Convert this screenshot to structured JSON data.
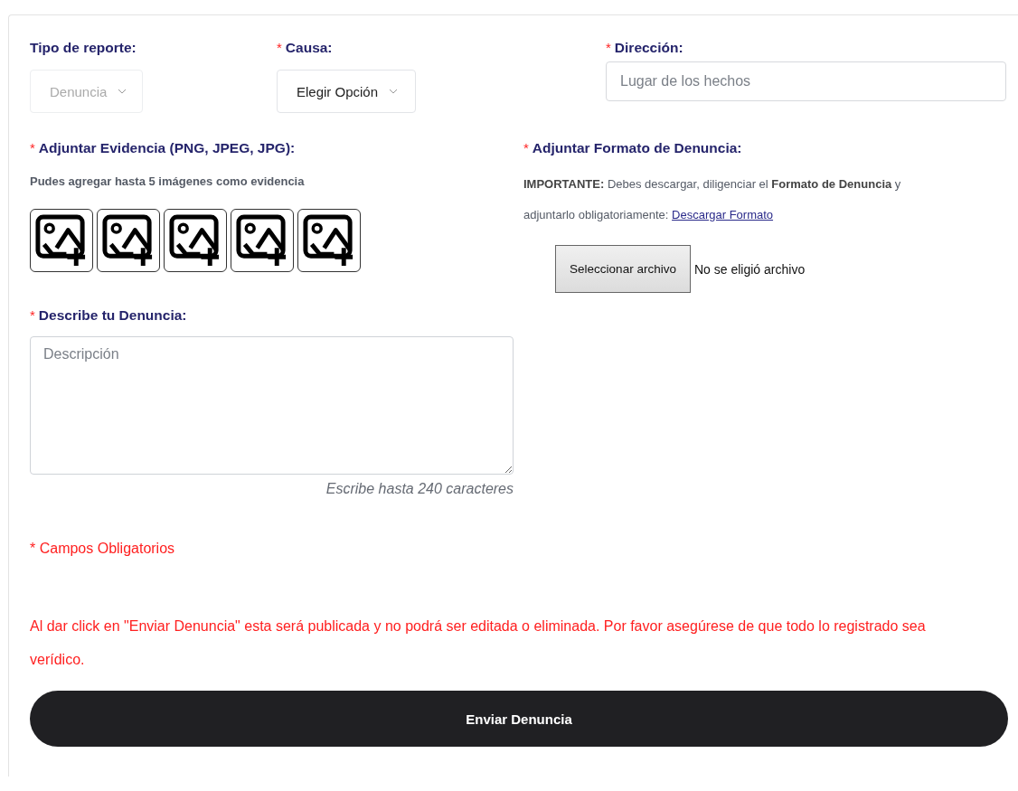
{
  "fields": [
    {
      "label": "Tipo de reporte:",
      "kind": "select",
      "value": "Denuncia",
      "disabled": true
    },
    {
      "mark": "*",
      "label": "Causa:",
      "kind": "select",
      "value": "Elegir Opción",
      "disabled": false
    },
    {
      "mark": "*",
      "label": "Dirección:",
      "kind": "text",
      "placeholder": "Lugar de los hechos",
      "disabled": false
    }
  ],
  "evidence": {
    "mark": "*",
    "label": "Adjuntar Evidencia (PNG, JPEG, JPG):",
    "hint": "Pudes agregar hasta 5 imágenes como evidencia",
    "slots": [
      {
        "kind": "empty"
      },
      {
        "kind": "empty"
      },
      {
        "kind": "empty"
      },
      {
        "kind": "empty"
      },
      {
        "kind": "empty"
      }
    ]
  },
  "format": {
    "mark": "*",
    "label": "Adjuntar Formato de Denuncia:",
    "note": "**IMPORTANTE:** Debes descargar, diligenciar el **Formato de Denuncia** y adjuntarlo obligatoriamente:",
    "link": "Descargar Formato",
    "file_button": "Seleccionar archivo",
    "file_status": "No se eligió archivo"
  },
  "description": {
    "mark": "*",
    "label": "Describe tu Denuncia:",
    "placeholder": "Descripción",
    "hint": "Escribe hasta 240 caracteres"
  },
  "required_note": "* Campos Obligatorios",
  "warning": "Al dar click en \"Enviar Denuncia\" esta será publicada y no podrá ser editada o eliminada. Por favor asegúrese de que todo lo registrado sea verídico.",
  "submit": "Enviar Denuncia"
}
